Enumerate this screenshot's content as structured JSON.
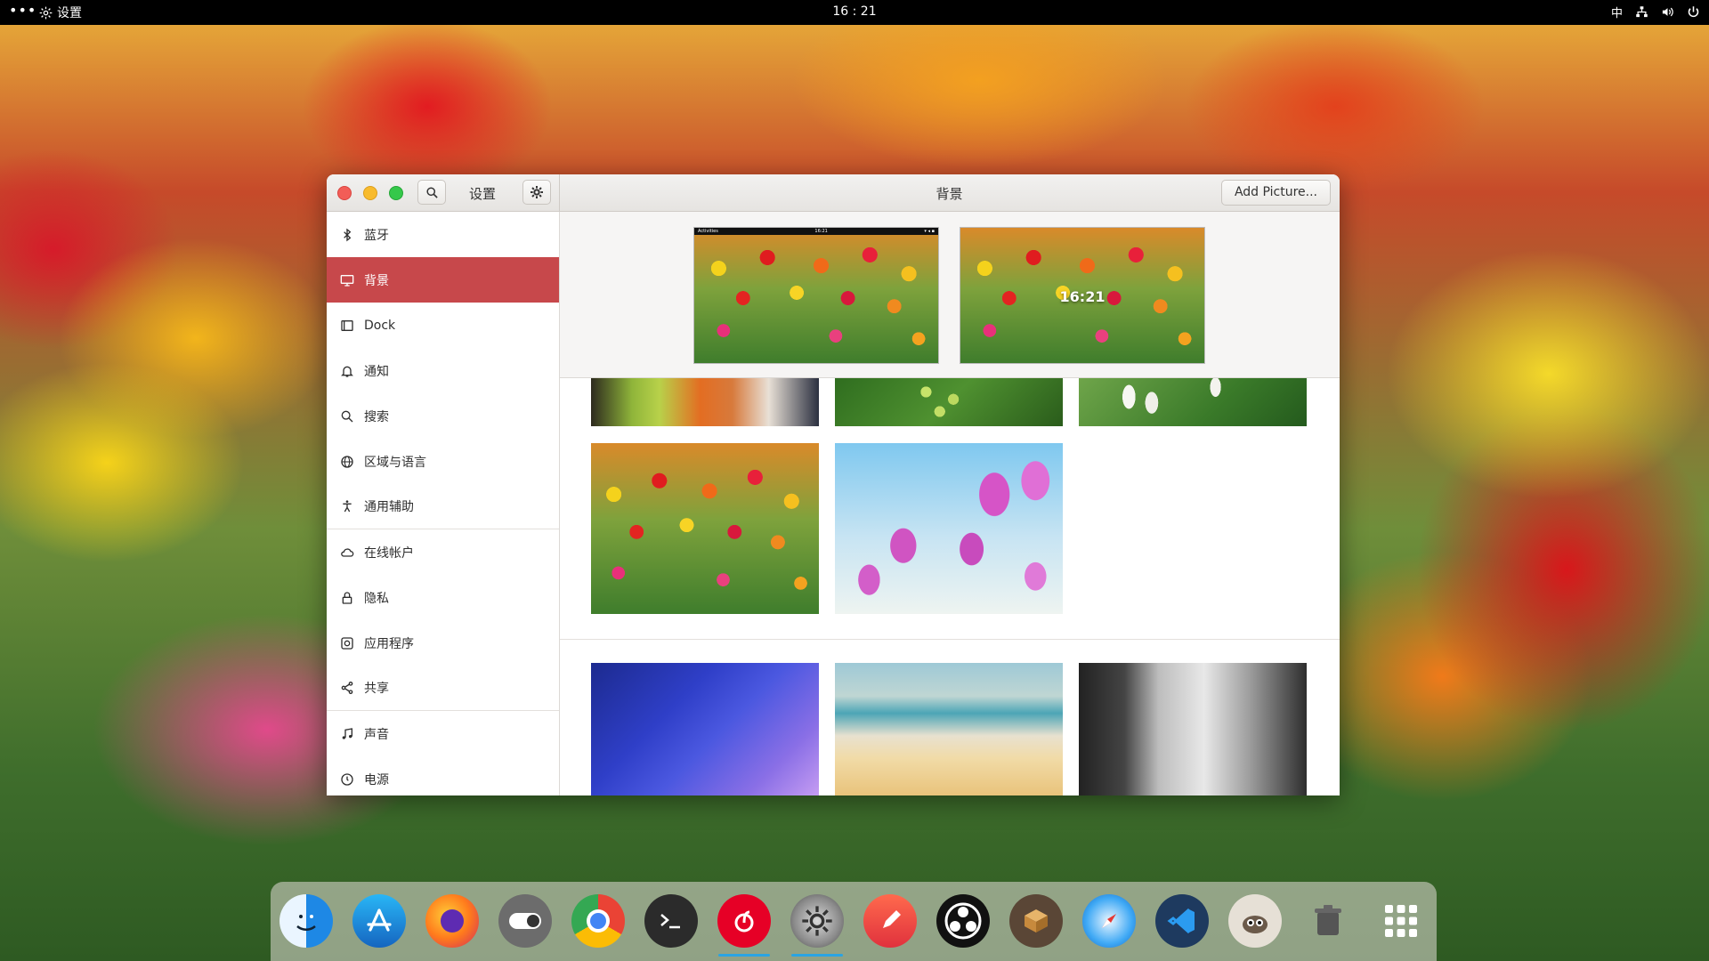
{
  "topbar": {
    "menu_dots": "•••",
    "app_name": "设置",
    "clock": "16 : 21",
    "input_method": "中"
  },
  "window": {
    "title_left": "设置",
    "title_center": "背景",
    "add_picture": "Add Picture..."
  },
  "sidebar": {
    "items": [
      {
        "label": "蓝牙",
        "icon": "bluetooth-icon"
      },
      {
        "label": "背景",
        "icon": "display-icon",
        "active": true
      },
      {
        "label": "Dock",
        "icon": "dock-icon"
      },
      {
        "label": "通知",
        "icon": "bell-icon"
      },
      {
        "label": "搜索",
        "icon": "search-icon"
      },
      {
        "label": "区域与语言",
        "icon": "globe-icon"
      },
      {
        "label": "通用辅助",
        "icon": "accessibility-icon"
      },
      {
        "label": "在线帐户",
        "icon": "cloud-icon"
      },
      {
        "label": "隐私",
        "icon": "lock-icon"
      },
      {
        "label": "应用程序",
        "icon": "apps-icon"
      },
      {
        "label": "共享",
        "icon": "share-icon"
      },
      {
        "label": "声音",
        "icon": "music-icon"
      },
      {
        "label": "电源",
        "icon": "power-icon"
      }
    ]
  },
  "previews": {
    "desktop_bar_left": "Activities",
    "desktop_bar_center": "16:21",
    "lock_time": "16:21"
  },
  "dock": {
    "apps": [
      "finder-icon",
      "app-store-icon",
      "firefox-icon",
      "toggle-icon",
      "chrome-icon",
      "terminal-icon",
      "netease-music-icon",
      "settings-icon",
      "pencil-icon",
      "obs-icon",
      "box-icon",
      "safari-icon",
      "vscode-icon",
      "gimp-icon",
      "trash-icon",
      "app-grid-icon"
    ]
  },
  "colors": {
    "accent": "#c7484b",
    "running_indicator": "#2aa4e3"
  }
}
